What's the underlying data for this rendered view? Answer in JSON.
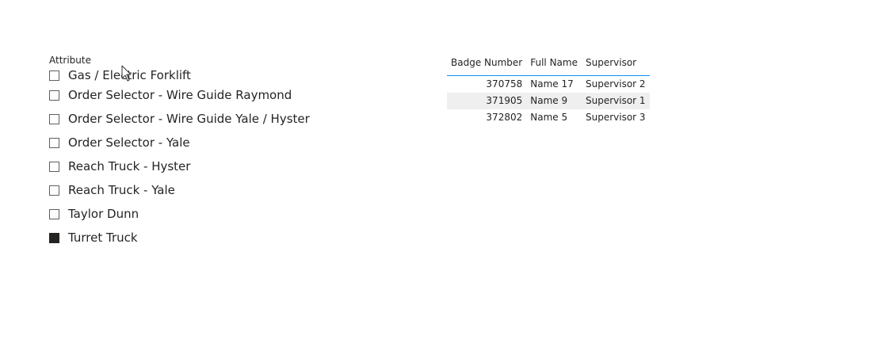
{
  "slicer": {
    "title": "Attribute",
    "items": [
      {
        "label": "Gas / Electric Forklift",
        "checked": false
      },
      {
        "label": "Order Selector - Wire Guide Raymond",
        "checked": false
      },
      {
        "label": "Order Selector - Wire Guide Yale / Hyster",
        "checked": false
      },
      {
        "label": "Order Selector - Yale",
        "checked": false
      },
      {
        "label": "Reach Truck - Hyster",
        "checked": false
      },
      {
        "label": "Reach Truck - Yale",
        "checked": false
      },
      {
        "label": "Taylor Dunn",
        "checked": false
      },
      {
        "label": "Turret Truck",
        "checked": true
      }
    ]
  },
  "table": {
    "headers": {
      "badge": "Badge Number",
      "name": "Full Name",
      "supervisor": "Supervisor"
    },
    "rows": [
      {
        "badge": "370758",
        "name": "Name 17",
        "supervisor": "Supervisor 2"
      },
      {
        "badge": "371905",
        "name": "Name 9",
        "supervisor": "Supervisor 1"
      },
      {
        "badge": "372802",
        "name": "Name 5",
        "supervisor": "Supervisor 3"
      }
    ]
  },
  "colors": {
    "header_underline": "#118dff",
    "checkbox_checked": "#252423",
    "alt_row": "#efefef"
  },
  "icons": {
    "cursor": "mouse-pointer-icon",
    "checkbox": "checkbox-icon"
  }
}
